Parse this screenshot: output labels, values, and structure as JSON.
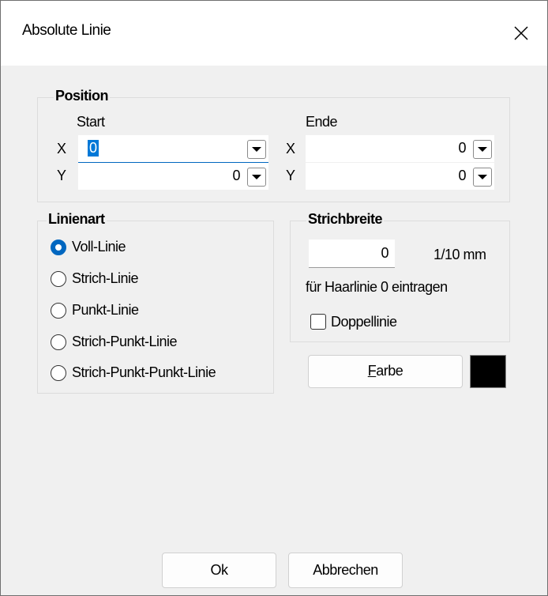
{
  "window": {
    "title": "Absolute Linie"
  },
  "position": {
    "group_title": "Position",
    "start_label": "Start",
    "end_label": "Ende",
    "x_label": "X",
    "y_label": "Y",
    "start_x": "0",
    "start_y": "0",
    "end_x": "0",
    "end_y": "0"
  },
  "linienart": {
    "group_title": "Linienart",
    "options": [
      "Voll-Linie",
      "Strich-Linie",
      "Punkt-Linie",
      "Strich-Punkt-Linie",
      "Strich-Punkt-Punkt-Linie"
    ],
    "selected": 0
  },
  "strichbreite": {
    "group_title": "Strichbreite",
    "value": "0",
    "unit": "1/10 mm",
    "hint": "für Haarlinie 0 eintragen",
    "double_line_label": "Doppellinie",
    "double_line_checked": false
  },
  "color": {
    "button_prefix": "",
    "button_mnemonic": "F",
    "button_rest": "arbe",
    "swatch_color": "#000000"
  },
  "buttons": {
    "ok": "Ok",
    "cancel": "Abbrechen"
  },
  "icons": {
    "close": "close-icon",
    "dropdown": "chevron-down-icon",
    "radio": "radio-button"
  }
}
